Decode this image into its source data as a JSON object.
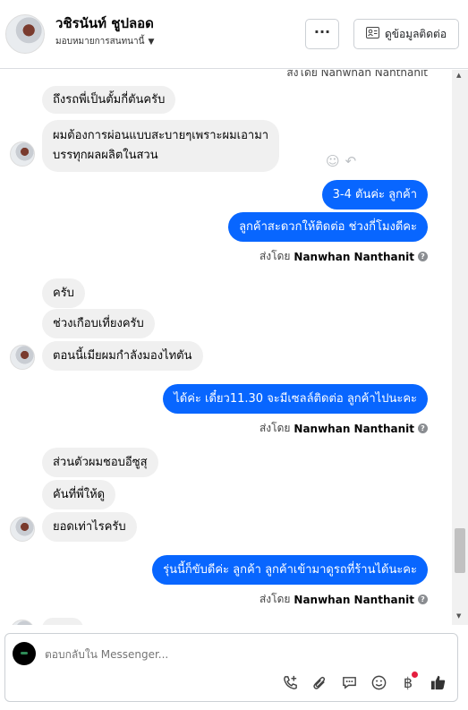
{
  "header": {
    "name": "วชิรนันท์ ชูปลอด",
    "assignee_label": "มอบหมายการสนทนานี้",
    "more_label": "···",
    "contact_button": "ดูข้อมูลติดต่อ"
  },
  "thread": {
    "cut_off_text": "ส่งโดย Nanwhan Nanthanit",
    "messages": [
      {
        "dir": "in",
        "text": "ถึงรถพี่เป็นตั้มกี่ตันครับ"
      },
      {
        "dir": "in",
        "text": "ผมต้องการผ่อนแบบสะบายๆเพราะผมเอามา\nบรรทุกผลผลิตในสวน"
      },
      {
        "dir": "out",
        "text": "3-4 ตันค่ะ ลูกค้า"
      },
      {
        "dir": "out",
        "text": "ลูกค้าสะดวกให้ติดต่อ ช่วงกี่โมงดีคะ"
      },
      {
        "dir": "in",
        "text": "ครับ"
      },
      {
        "dir": "in",
        "text": "ช่วงเกือบเที่ยงครับ"
      },
      {
        "dir": "in",
        "text": "ตอนนี้เมียผมกำลังมองไทตัน"
      },
      {
        "dir": "out",
        "text": "ได้ค่ะ เดี๋ยว11.30 จะมีเซลล์ติดต่อ ลูกค้าไปนะคะ"
      },
      {
        "dir": "in",
        "text": "ส่วนตัวผมชอบอีซูสุ"
      },
      {
        "dir": "in",
        "text": "คันที่พี่ให้ดู"
      },
      {
        "dir": "in",
        "text": "ยอดเท่าไรครับ"
      },
      {
        "dir": "out",
        "text": "รุ่นนี้ก็ขับดีค่ะ ลูกค้า ลูกค้าเข้ามาดูรถที่ร้านได้นะคะ"
      }
    ],
    "sent_by_prefix": "ส่งโดย",
    "sent_by_name": "Nanwhan Nanthanit",
    "info_glyph": "?"
  },
  "composer": {
    "placeholder": "ตอบกลับใน Messenger..."
  },
  "icons": {
    "reply_tools": [
      "call-add-icon",
      "paperclip-icon",
      "chat-bubble-icon",
      "emoji-icon",
      "baht-icon",
      "thumbs-up-icon"
    ],
    "message_actions": [
      "emoji-react-icon",
      "reply-icon"
    ]
  },
  "colors": {
    "outgoing_bubble": "#0866ff",
    "incoming_bubble": "#f0f0f0",
    "notification_dot": "#e41e3f"
  }
}
